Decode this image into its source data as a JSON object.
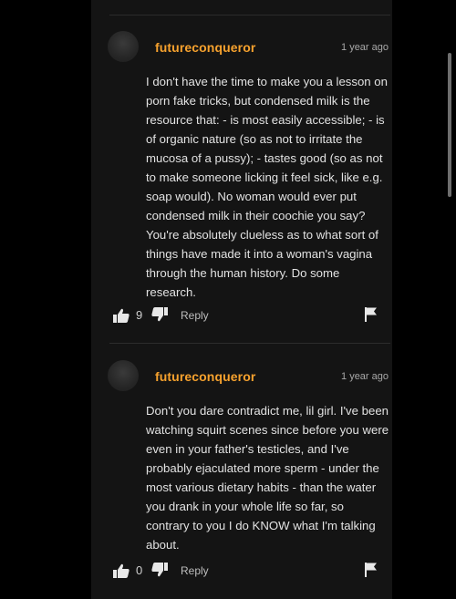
{
  "comments": [
    {
      "username": "futureconqueror",
      "timestamp": "1 year ago",
      "text": "I don't have the time to make you a lesson on porn fake tricks, but condensed milk is the resource that: - is most easily accessible; - is of organic nature (so as not to irritate the mucosa of a pussy); - tastes good (so as not to make someone licking it feel sick, like e.g. soap would). No woman would ever put condensed milk in their coochie you say? You're absolutely clueless as to what sort of things have made it into a woman's vagina through the human history. Do some research.",
      "likes": "9",
      "reply_label": "Reply"
    },
    {
      "username": "futureconqueror",
      "timestamp": "1 year ago",
      "text": "Don't you dare contradict me, lil girl. I've been watching squirt scenes since before you were even in your father's testicles, and I've probably ejaculated more sperm - under the most various dietary habits - than the water you drank in your whole life so far, so contrary to you I do KNOW what I'm talking about.",
      "likes": "0",
      "reply_label": "Reply"
    }
  ],
  "icons": {
    "like": "thumbs-up-icon",
    "dislike": "thumbs-down-icon",
    "flag": "flag-icon"
  },
  "colors": {
    "background": "#000000",
    "panel": "#141414",
    "username": "#f7a22e",
    "text": "#e2e2e2",
    "muted": "#a8a8a8"
  }
}
